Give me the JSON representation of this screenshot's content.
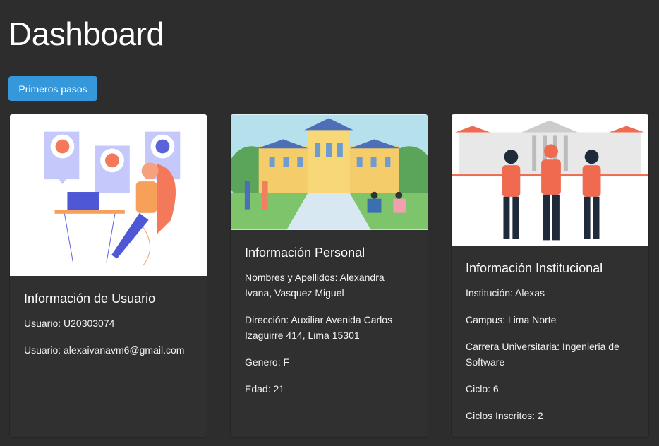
{
  "page_title": "Dashboard",
  "primary_button": "Primeros pasos",
  "cards": [
    {
      "title": "Información de Usuario",
      "image_icon": "support-agent-illustration",
      "fields": [
        "Usuario: U20303074",
        "Usuario: alexaivanavm6@gmail.com"
      ]
    },
    {
      "title": "Información Personal",
      "image_icon": "campus-students-illustration",
      "fields": [
        "Nombres y Apellidos: Alexandra Ivana, Vasquez Miguel",
        "Dirección: Auxiliar Avenida Carlos Izaguirre 414, Lima 15301",
        "Genero: F",
        "Edad: 21"
      ]
    },
    {
      "title": "Información Institucional",
      "image_icon": "university-students-illustration",
      "fields": [
        "Institución: Alexas",
        "Campus: Lima Norte",
        "Carrera Universitaria: Ingenieria de Software",
        "Ciclo: 6",
        "Ciclos Inscritos: 2"
      ]
    }
  ],
  "colors": {
    "background": "#2d2d2d",
    "card": "#303030",
    "button": "#3498db"
  }
}
